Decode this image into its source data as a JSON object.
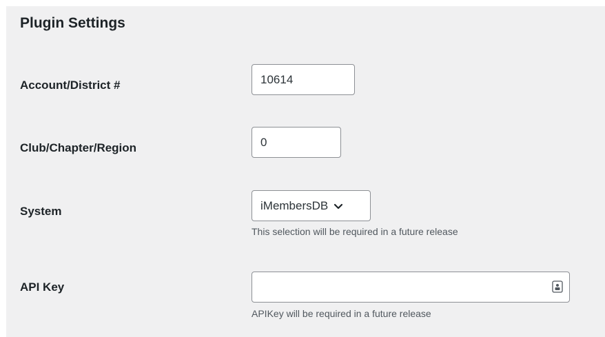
{
  "title": "Plugin Settings",
  "fields": {
    "account": {
      "label": "Account/District #",
      "value": "10614"
    },
    "club": {
      "label": "Club/Chapter/Region",
      "value": "0"
    },
    "system": {
      "label": "System",
      "selected": "iMembersDB",
      "help": "This selection will be required in a future release"
    },
    "api_key": {
      "label": "API Key",
      "value": "",
      "help": "APIKey will be required in a future release"
    }
  },
  "icons": {
    "select_arrow": "chevron-down-icon",
    "api_key_field": "password-manager-icon"
  },
  "colors": {
    "panel_bg": "#f0f0f1",
    "input_border": "#8c8f94",
    "label_text": "#1d2327",
    "help_text": "#50575e"
  }
}
